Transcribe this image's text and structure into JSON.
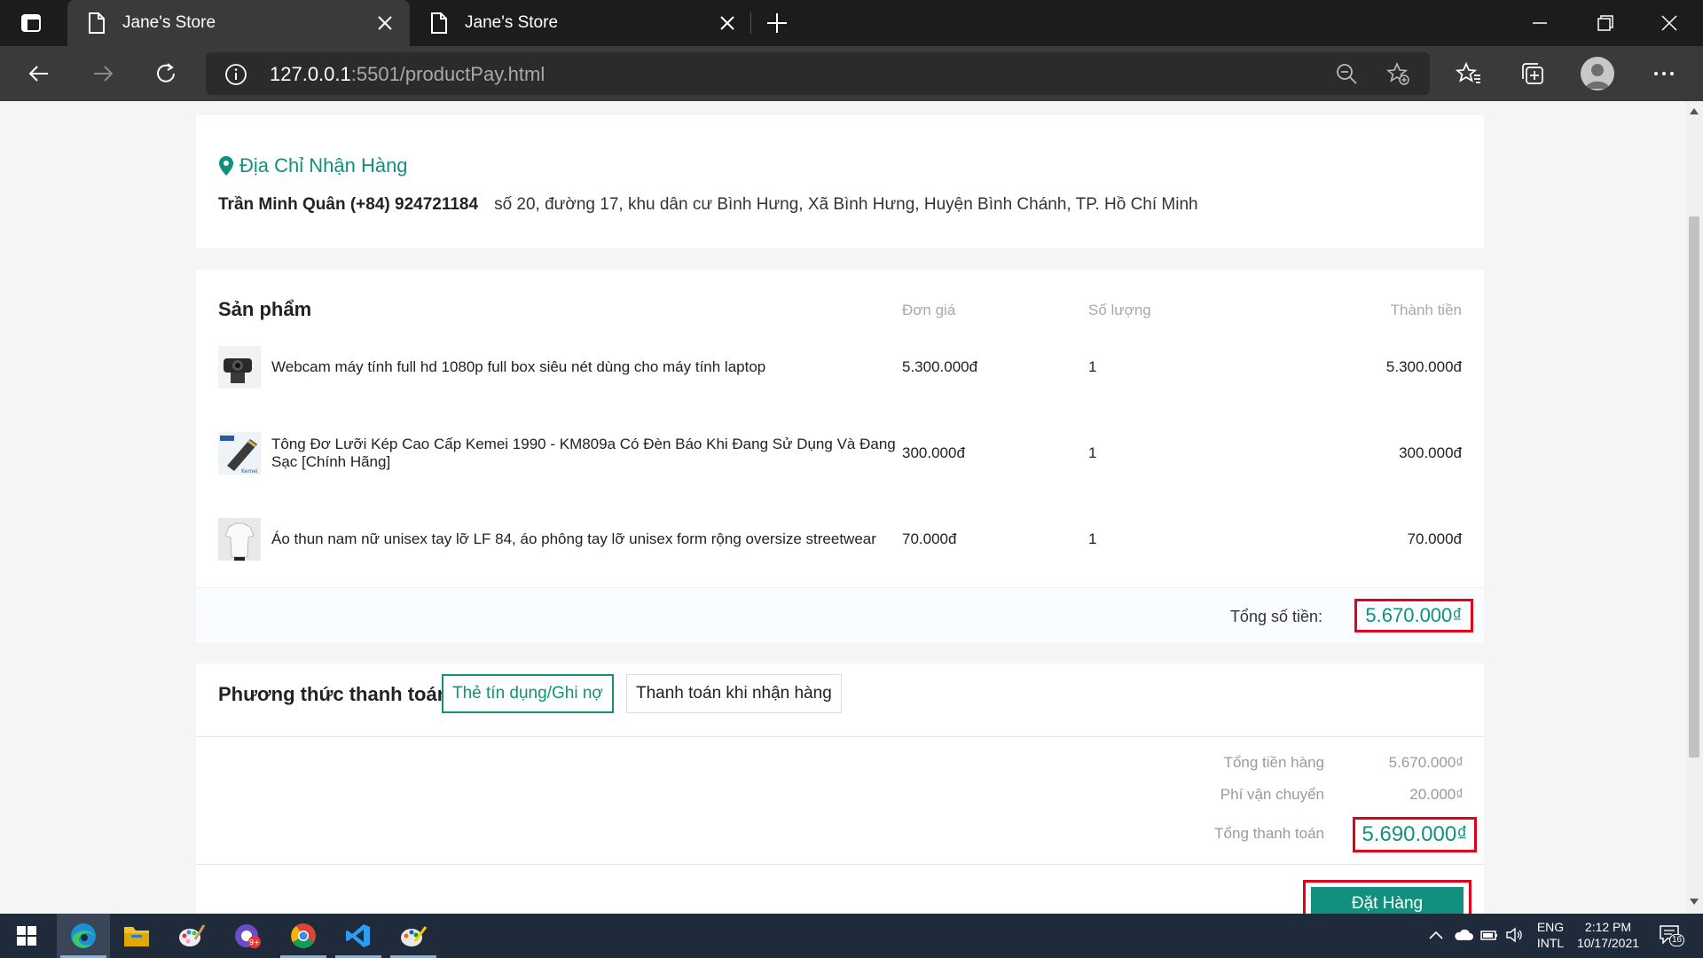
{
  "browser": {
    "tabs": [
      {
        "title": "Jane's Store",
        "active": true
      },
      {
        "title": "Jane's Store",
        "active": false
      }
    ],
    "url_host": "127.0.0.1",
    "url_rest": ":5501/productPay.html"
  },
  "address": {
    "heading": "Địa Chỉ Nhận Hàng",
    "name_phone": "Trần Minh Quân (+84) 924721184",
    "detail": "số 20, đường 17, khu dân cư Bình Hưng, Xã Bình Hưng, Huyện Bình Chánh, TP. Hồ Chí Minh"
  },
  "products": {
    "title": "Sản phẩm",
    "col_price": "Đơn giá",
    "col_qty": "Số lượng",
    "col_total": "Thành tiền",
    "items": [
      {
        "name": "Webcam máy tính full hd 1080p full box siêu nét dùng cho máy tính laptop",
        "price": "5.300.000đ",
        "qty": "1",
        "total": "5.300.000đ"
      },
      {
        "name": "Tông Đơ Lưỡi Kép Cao Cấp Kemei 1990 - KM809a Có Đèn Báo Khi Đang Sử Dụng Và Đang Sạc [Chính Hãng]",
        "price": "300.000đ",
        "qty": "1",
        "total": "300.000đ"
      },
      {
        "name": "Áo thun nam nữ unisex tay lỡ LF 84, áo phông tay lỡ unisex form rộng oversize streetwear",
        "price": "70.000đ",
        "qty": "1",
        "total": "70.000đ"
      }
    ],
    "sum_label": "Tổng số tiền:",
    "sum_value": "5.670.000₫"
  },
  "payment": {
    "title": "Phương thức thanh toán",
    "option_card": "Thẻ tín dụng/Ghi nợ",
    "option_cod": "Thanh toán khi nhận hàng",
    "goods_label": "Tổng tiền hàng",
    "goods_value": "5.670.000₫",
    "shipping_label": "Phí vận chuyển",
    "shipping_value": "20.000₫",
    "grand_label": "Tổng thanh toán",
    "grand_value": "5.690.000₫",
    "order_button": "Đặt Hàng"
  },
  "taskbar": {
    "lang_top": "ENG",
    "lang_bottom": "INTL",
    "time": "2:12 PM",
    "date": "10/17/2021",
    "notification_count": "16"
  }
}
